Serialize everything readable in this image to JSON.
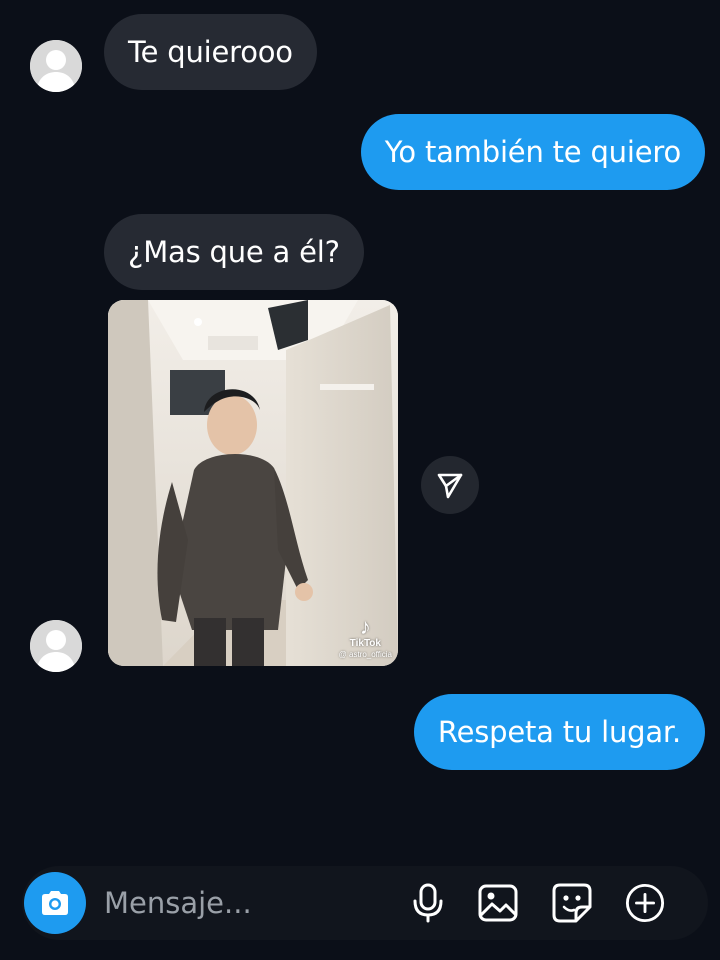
{
  "messages": [
    {
      "direction": "incoming",
      "text": "Te quierooo"
    },
    {
      "direction": "outgoing",
      "text": "Yo también te quiero"
    },
    {
      "direction": "incoming",
      "text": "¿Mas que a él?"
    },
    {
      "direction": "incoming",
      "type": "video",
      "watermark": {
        "brand": "TikTok",
        "handle": "@ astro_officia"
      }
    },
    {
      "direction": "outgoing",
      "text": "Respeta tu lugar."
    }
  ],
  "composer": {
    "placeholder": "Mensaje...",
    "value": "",
    "icons": [
      "camera-icon",
      "microphone-icon",
      "gallery-icon",
      "sticker-icon",
      "add-icon"
    ]
  },
  "colors": {
    "background": "#0b0f18",
    "incoming_bubble": "#262a33",
    "outgoing_bubble": "#1e9bf0",
    "accent": "#1e9bf0"
  }
}
